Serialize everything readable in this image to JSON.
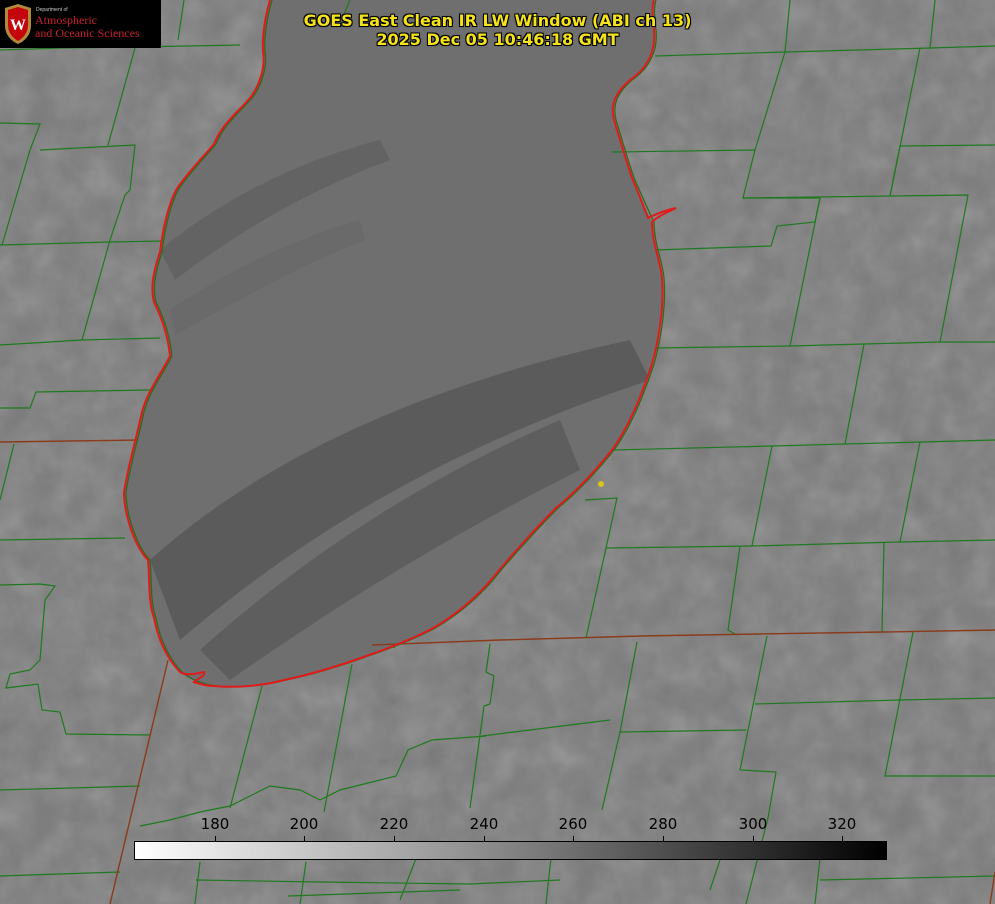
{
  "title": {
    "line1": "GOES East Clean IR LW Window (ABI ch 13)",
    "line2": "2025 Dec 05 10:46:18 GMT"
  },
  "logo": {
    "crest_letter": "W",
    "department": "Department of",
    "line1": "Atmospheric",
    "line2": "and Oceanic Sciences"
  },
  "colorbar": {
    "range": [
      162,
      330
    ],
    "ticks": [
      "180",
      "200",
      "220",
      "240",
      "260",
      "280",
      "300",
      "320"
    ],
    "colormap": "white-to-black (brightness temperature)"
  },
  "colors": {
    "land_gray": "#7a7a7a",
    "lake_gray": "#6c6c6c",
    "shoreline": "#e01b1b",
    "county_lines": "#1e7a1e",
    "state_lines": "#8b3a1a",
    "title": "#f4e21a",
    "marker": "#d8c41c"
  },
  "icons": {
    "logo": "uw-crest-icon",
    "marker": "location-marker-icon"
  }
}
